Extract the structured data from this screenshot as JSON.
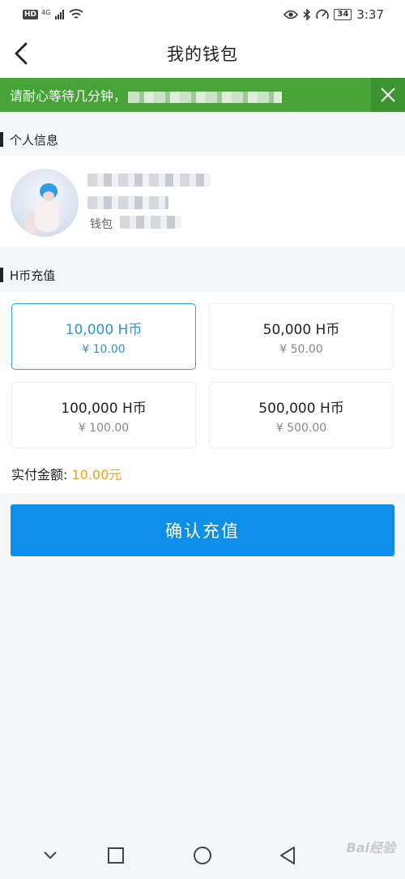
{
  "status_bar": {
    "hd": "HD",
    "network": "4G",
    "battery": "34",
    "time": "3:37"
  },
  "nav": {
    "title": "我的钱包"
  },
  "notice": {
    "text": "请耐心等待几分钟，"
  },
  "profile_section": {
    "title": "个人信息",
    "wallet_label": "钱包"
  },
  "recharge_section": {
    "title": "H币充值",
    "options": [
      {
        "amount": "10,000 H币",
        "price": "¥ 10.00",
        "selected": true
      },
      {
        "amount": "50,000 H币",
        "price": "¥ 50.00",
        "selected": false
      },
      {
        "amount": "100,000 H币",
        "price": "¥ 100.00",
        "selected": false
      },
      {
        "amount": "500,000 H币",
        "price": "¥ 500.00",
        "selected": false
      }
    ],
    "pay_label": "实付金额: ",
    "pay_value": "10.00元"
  },
  "confirm_button": "确认充值",
  "watermark": "Bai经验",
  "colors": {
    "notice_green": "#46a336",
    "primary_blue": "#0d8fe8",
    "selected_blue": "#2e95cf",
    "pay_orange": "#f0a01a"
  }
}
